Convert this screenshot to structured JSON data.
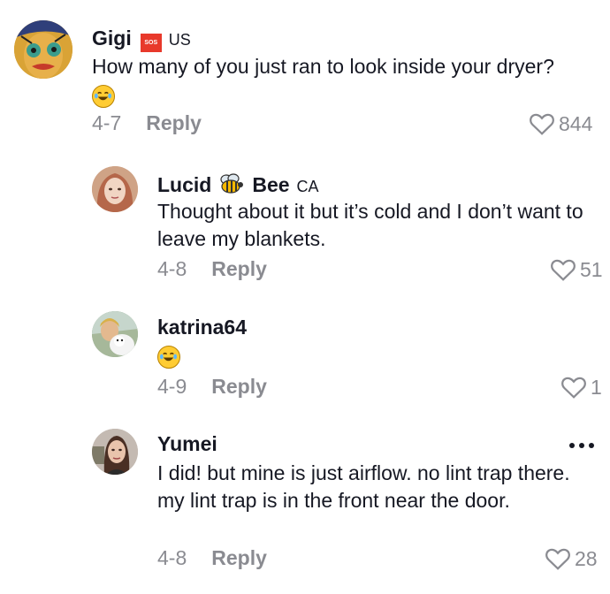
{
  "comments": [
    {
      "username": "Gigi",
      "badge": "SOS",
      "region": "US",
      "text": "How many of you just ran to look inside your dryer?",
      "emoji": "laughing-tears",
      "date": "4-7",
      "reply_label": "Reply",
      "likes": "844"
    },
    {
      "username": "Lucid",
      "username_suffix": "Bee",
      "region": "CA",
      "text": "Thought about it but it’s cold and I don’t want to leave my blankets.",
      "date": "4-8",
      "reply_label": "Reply",
      "likes": "51"
    },
    {
      "username": "katrina64",
      "region": "",
      "emoji": "laughing-tears",
      "date": "4-9",
      "reply_label": "Reply",
      "likes": "1"
    },
    {
      "username": "Yumei",
      "region": "",
      "text": "I did! but mine is just airflow. no lint trap there. my lint trap is in the front near the door.",
      "date": "4-8",
      "reply_label": "Reply",
      "likes": "28"
    }
  ],
  "colors": {
    "text": "#161823",
    "muted": "#8a8b91",
    "badge": "#e8392b"
  }
}
